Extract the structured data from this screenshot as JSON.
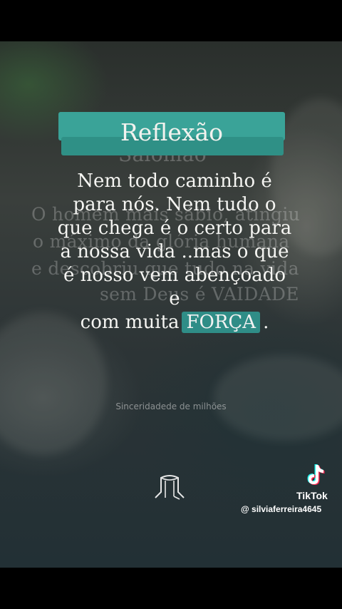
{
  "quote": {
    "heading": "Reflexão",
    "lines": [
      "Nem todo caminho é",
      "para nós. Nem tudo o",
      "que chega é o certo para",
      "a nossa vida ..mas o que",
      "é nosso vem abençoado e"
    ],
    "last_line_prefix": "com muita",
    "highlight_word": "FORÇA",
    "last_line_suffix": "."
  },
  "background_text": {
    "title": "Salomão",
    "lines": [
      "O homem mais sábio, atingiu",
      "o máximo da glória humana",
      "e descobriu que tudo na vida",
      "sem Deus é VAIDADE"
    ]
  },
  "credit": "Sinceridadede de milhões",
  "watermark": {
    "brand": "TikTok",
    "handle": "@ silviaferreira4645",
    "icon": "tiktok-note-icon"
  },
  "colors": {
    "banner": "#3aa398",
    "highlight": "#2f8d87",
    "text": "#f5f5f2"
  }
}
